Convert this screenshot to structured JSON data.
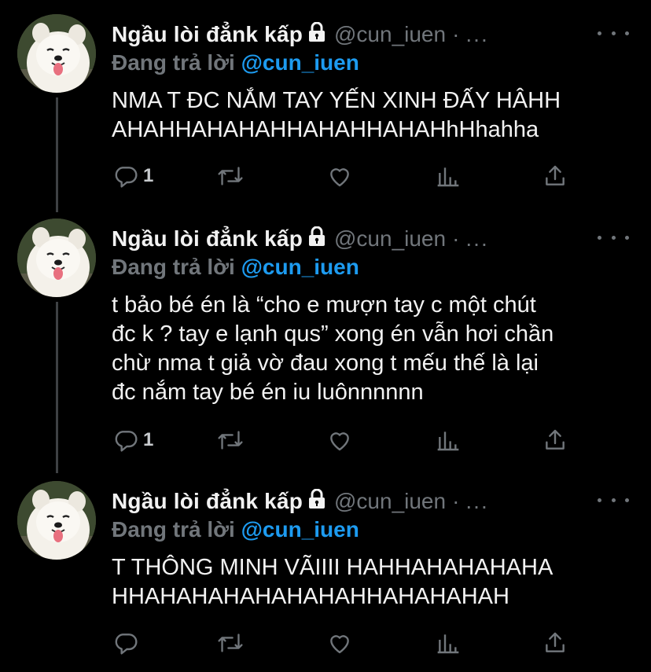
{
  "tweets": [
    {
      "display_name": "Ngầu lòi đẳnk kấp",
      "handle": "@cun_iuen",
      "separator": "·",
      "time": "...",
      "reply_label": "Đang trả lời",
      "reply_to": "@cun_iuen",
      "text_lines": [
        "NMA T ĐC NẮM TAY YẾN XINH ĐẤY HÂHH",
        "AHAHHAHAHAHHAHAHHAHAHhHhahha"
      ],
      "reply_count": "1"
    },
    {
      "display_name": "Ngầu lòi đẳnk kấp",
      "handle": "@cun_iuen",
      "separator": "·",
      "time": "...",
      "reply_label": "Đang trả lời",
      "reply_to": "@cun_iuen",
      "text_lines": [
        "t bảo bé én là “cho e mượn tay c một chút",
        "đc k ? tay e lạnh qus” xong én vẫn hơi chần",
        "chừ nma t giả vờ đau xong t mếu thế là lại",
        "đc nắm tay bé én iu luônnnnnn"
      ],
      "reply_count": "1"
    },
    {
      "display_name": "Ngầu lòi đẳnk kấp",
      "handle": "@cun_iuen",
      "separator": "·",
      "time": "...",
      "reply_label": "Đang trả lời",
      "reply_to": "@cun_iuen",
      "text_lines": [
        "T THÔNG MINH VÃIIII HAHHAHAHAHAHA",
        "HHAHAHAHAHAHAHAHHAHAHAHAH"
      ],
      "reply_count": ""
    }
  ],
  "colors": {
    "background": "#000000",
    "text": "#e7e9ea",
    "muted": "#71767b",
    "link": "#1d9bf0",
    "thread_line": "#3e4144"
  },
  "icons": [
    "lock-icon",
    "more-options-icon",
    "reply-icon",
    "retweet-icon",
    "like-icon",
    "analytics-icon",
    "share-icon"
  ]
}
